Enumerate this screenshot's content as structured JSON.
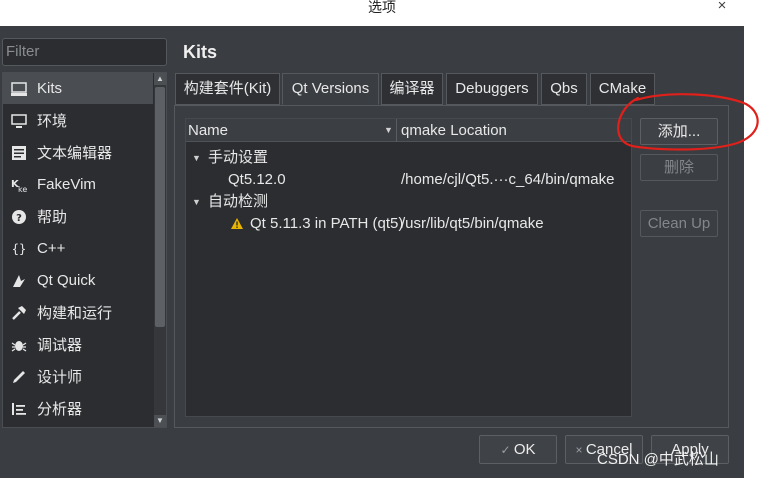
{
  "window": {
    "title": "选项",
    "close_glyph": "×"
  },
  "filter": {
    "placeholder": "Filter"
  },
  "sidebar": {
    "items": [
      {
        "label": "Kits",
        "icon": "kits-icon",
        "active": true
      },
      {
        "label": "环境",
        "icon": "monitor-icon"
      },
      {
        "label": "文本编辑器",
        "icon": "text-editor-icon"
      },
      {
        "label": "FakeVim",
        "icon": "fakevim-icon"
      },
      {
        "label": "帮助",
        "icon": "help-icon"
      },
      {
        "label": "C++",
        "icon": "braces-icon"
      },
      {
        "label": "Qt Quick",
        "icon": "qt-quick-icon"
      },
      {
        "label": "构建和运行",
        "icon": "hammer-icon"
      },
      {
        "label": "调试器",
        "icon": "bug-icon"
      },
      {
        "label": "设计师",
        "icon": "pen-icon"
      },
      {
        "label": "分析器",
        "icon": "analyzer-icon"
      }
    ]
  },
  "page": {
    "title": "Kits"
  },
  "tabs": [
    {
      "label": "构建套件(Kit)"
    },
    {
      "label": "Qt Versions",
      "active": true
    },
    {
      "label": "编译器"
    },
    {
      "label": "Debuggers"
    },
    {
      "label": "Qbs"
    },
    {
      "label": "CMake"
    }
  ],
  "versions_table": {
    "columns": [
      "Name",
      "qmake Location"
    ],
    "groups": [
      {
        "label": "手动设置",
        "rows": [
          {
            "name": "Qt5.12.0",
            "location": "/home/cjl/Qt5.···c_64/bin/qmake"
          }
        ]
      },
      {
        "label": "自动检测",
        "rows": [
          {
            "name": "Qt 5.11.3 in PATH (qt5)",
            "location": "/usr/lib/qt5/bin/qmake",
            "warning": true
          }
        ]
      }
    ]
  },
  "actions": {
    "add": "添加...",
    "remove": "删除",
    "clean_up": "Clean Up"
  },
  "footer": {
    "ok": "OK",
    "cancel": "Cancel",
    "apply": "Apply"
  },
  "watermark": "CSDN @中武松山",
  "colors": {
    "annotation": "#e0201a",
    "warning": "#e8b400",
    "background": "#3a3d41"
  }
}
